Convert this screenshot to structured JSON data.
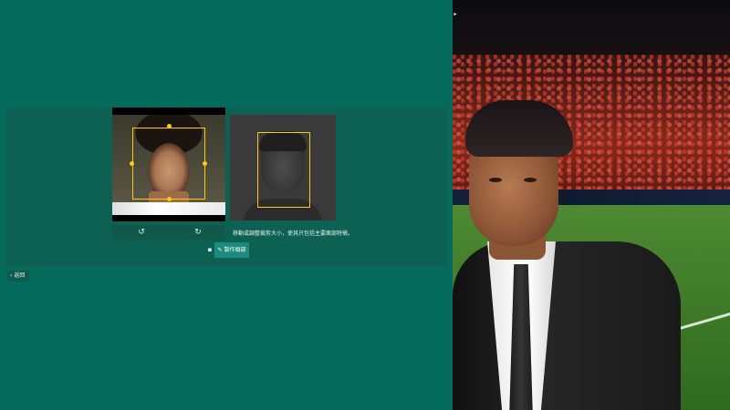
{
  "editor": {
    "instruction": "移動或調整裁剪大小，使其只包括主要面部特徵。",
    "make_face_label": "製作頭部",
    "back_label": "返回",
    "rotate_left_icon": "↺",
    "rotate_right_icon": "↻",
    "folder_icon": "▪",
    "pencil_icon": "✎",
    "back_icon": "‹",
    "corner_icon": "▸"
  },
  "colors": {
    "background": "#046b5c",
    "panel": "#0c6152",
    "accent_button": "#1c8a7e",
    "crop_frame": "#ffcc00"
  }
}
